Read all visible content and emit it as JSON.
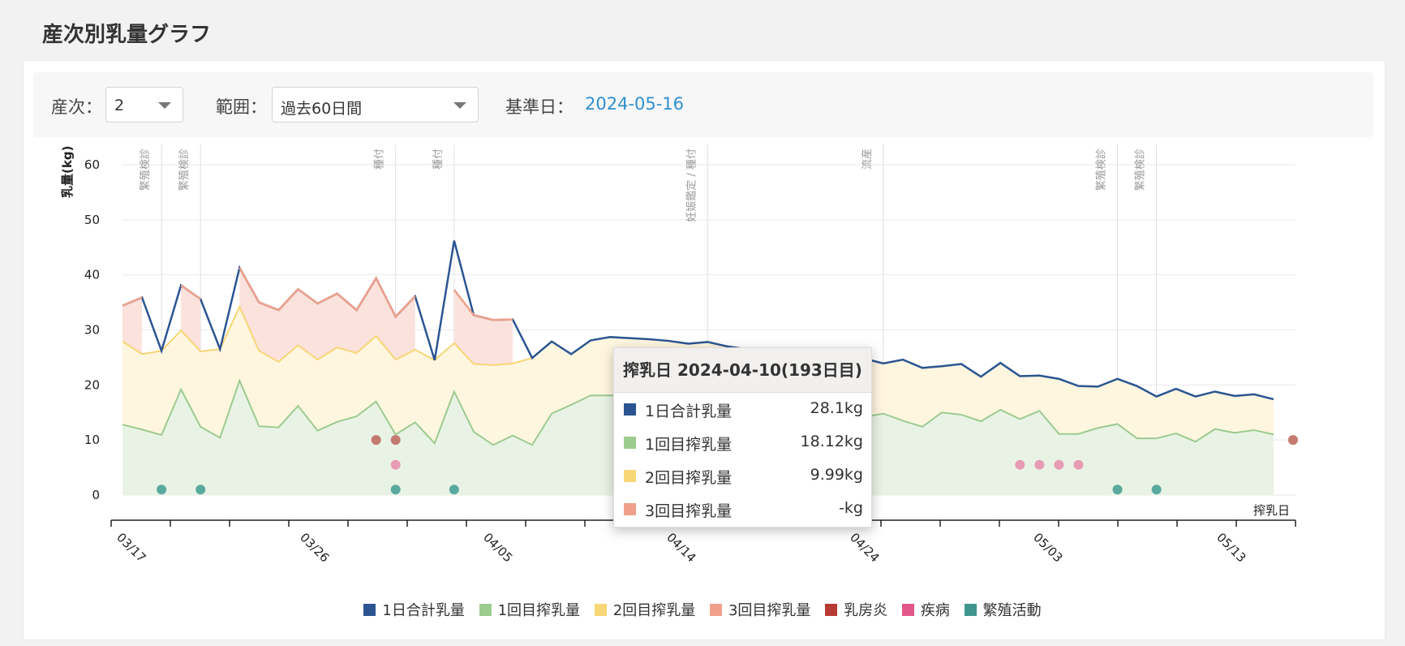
{
  "page_title": "産次別乳量グラフ",
  "filters": {
    "parity_label": "産次：",
    "parity_value": "2",
    "range_label": "範囲：",
    "range_value": "過去60日間",
    "base_date_label": "基準日：",
    "base_date_value": "2024-05-16"
  },
  "colors": {
    "total": "#2b5592",
    "milk1": "#9ccb8f",
    "milk2": "#f7d675",
    "milk3": "#f0a08a",
    "mastitis": "#b83a32",
    "disease": "#e2578a",
    "breeding": "#3e968e",
    "marker_mastitis": "#c47a6e",
    "marker_disease": "#e89bb4",
    "marker_breeding": "#5aa99e"
  },
  "tooltip": {
    "title": "搾乳日 2024-04-10(193日目)",
    "rows": [
      {
        "name": "1日合計乳量",
        "value": "28.1kg",
        "color_key": "total"
      },
      {
        "name": "1回目搾乳量",
        "value": "18.12kg",
        "color_key": "milk1"
      },
      {
        "name": "2回目搾乳量",
        "value": "9.99kg",
        "color_key": "milk2"
      },
      {
        "name": "3回目搾乳量",
        "value": "-kg",
        "color_key": "milk3"
      }
    ]
  },
  "legend": [
    {
      "label": "1日合計乳量",
      "color_key": "total"
    },
    {
      "label": "1回目搾乳量",
      "color_key": "milk1"
    },
    {
      "label": "2回目搾乳量",
      "color_key": "milk2"
    },
    {
      "label": "3回目搾乳量",
      "color_key": "milk3"
    },
    {
      "label": "乳房炎",
      "color_key": "mastitis"
    },
    {
      "label": "疾病",
      "color_key": "disease"
    },
    {
      "label": "繁殖活動",
      "color_key": "breeding"
    }
  ],
  "chart_data": {
    "type": "area",
    "ylabel": "乳量(kg)",
    "xlabel": "搾乳日",
    "ylim": [
      0,
      60
    ],
    "yticks": [
      0,
      10,
      20,
      30,
      40,
      50,
      60
    ],
    "x_start": "03/16",
    "x_end": "05/16",
    "x_tick_labels": [
      "03/17",
      "03/26",
      "04/05",
      "04/14",
      "04/24",
      "05/03",
      "05/13"
    ],
    "grid": true,
    "legend_position": "bottom",
    "series": [
      {
        "name": "1回目搾乳量",
        "color_key": "milk1",
        "values": [
          12.8,
          11.9,
          10.9,
          19.2,
          12.4,
          10.4,
          20.8,
          12.5,
          12.3,
          16.2,
          11.7,
          13.3,
          14.3,
          17.0,
          11.0,
          13.2,
          9.4,
          18.8,
          11.5,
          9.1,
          10.8,
          9.1,
          14.8,
          16.4,
          18.1,
          18.1,
          18.1,
          18.1,
          18.1,
          18.0,
          18.0,
          18.0,
          16.5,
          16.5,
          16.5,
          16.5,
          16.0,
          15.5,
          14.2,
          14.8,
          13.5,
          12.4,
          15.0,
          14.6,
          13.4,
          15.5,
          13.8,
          15.3,
          11.1,
          11.1,
          12.2,
          12.9,
          10.3,
          10.3,
          11.2,
          9.7,
          12.0,
          11.3,
          11.8,
          11.0
        ]
      },
      {
        "name": "2回目搾乳量",
        "color_key": "milk2",
        "values": [
          27.9,
          25.6,
          26.2,
          29.9,
          26.1,
          26.5,
          34.2,
          26.2,
          24.2,
          27.2,
          24.6,
          26.8,
          25.8,
          28.9,
          24.6,
          26.4,
          24.5,
          27.6,
          23.8,
          23.6,
          23.9,
          24.9,
          27.9,
          25.6,
          28.1,
          28.7,
          28.5,
          28.3,
          28.0,
          27.5,
          27.8,
          27.0,
          26.5,
          26.0,
          26.0,
          25.5,
          25.0,
          25.0,
          24.8,
          23.9,
          24.6,
          23.1,
          23.4,
          23.8,
          21.5,
          24.0,
          21.6,
          21.7,
          21.1,
          19.8,
          19.7,
          21.1,
          19.8,
          17.9,
          19.3,
          17.9,
          18.8,
          18.0,
          18.3,
          17.4
        ]
      },
      {
        "name": "3回目搾乳量",
        "color_key": "milk3",
        "values": [
          34.4,
          35.9,
          null,
          38.1,
          35.6,
          null,
          41.3,
          35.0,
          33.6,
          37.4,
          34.8,
          36.6,
          33.6,
          39.4,
          32.4,
          36.1,
          null,
          37.3,
          32.7,
          31.8,
          31.9,
          null,
          null,
          null,
          null,
          null,
          null,
          null,
          null,
          null,
          null,
          null,
          null,
          null,
          null,
          null,
          null,
          null,
          null,
          null,
          null,
          null,
          null,
          null,
          null,
          null,
          null,
          null,
          null,
          null,
          null,
          null,
          null,
          null,
          null,
          null,
          null,
          null,
          null,
          null
        ]
      },
      {
        "name": "1日合計乳量",
        "color_key": "total",
        "values": [
          34.4,
          35.9,
          26.2,
          38.1,
          35.6,
          26.5,
          41.3,
          35.0,
          33.6,
          37.4,
          34.8,
          36.6,
          33.6,
          39.4,
          32.4,
          36.1,
          24.5,
          46.2,
          32.7,
          31.8,
          31.9,
          24.9,
          27.9,
          25.6,
          28.1,
          28.7,
          28.5,
          28.3,
          28.0,
          27.5,
          27.8,
          27.0,
          26.5,
          26.0,
          26.0,
          25.5,
          25.0,
          25.0,
          24.8,
          23.9,
          24.6,
          23.1,
          23.4,
          23.8,
          21.5,
          24.0,
          21.6,
          21.7,
          21.1,
          19.8,
          19.7,
          21.1,
          19.8,
          17.9,
          19.3,
          17.9,
          18.8,
          18.0,
          18.3,
          17.4
        ]
      }
    ],
    "event_markers": [
      {
        "day": 2,
        "y": 1,
        "type": "breeding"
      },
      {
        "day": 4,
        "y": 1,
        "type": "breeding"
      },
      {
        "day": 13,
        "y": 10,
        "type": "mastitis"
      },
      {
        "day": 14,
        "y": 10,
        "type": "mastitis"
      },
      {
        "day": 14,
        "y": 5.5,
        "type": "disease"
      },
      {
        "day": 14,
        "y": 1,
        "type": "breeding"
      },
      {
        "day": 17,
        "y": 1,
        "type": "breeding"
      },
      {
        "day": 38,
        "y": 1,
        "type": "breeding"
      },
      {
        "day": 46,
        "y": 5.5,
        "type": "disease"
      },
      {
        "day": 47,
        "y": 5.5,
        "type": "disease"
      },
      {
        "day": 48,
        "y": 5.5,
        "type": "disease"
      },
      {
        "day": 49,
        "y": 5.5,
        "type": "disease"
      },
      {
        "day": 51,
        "y": 1,
        "type": "breeding"
      },
      {
        "day": 53,
        "y": 1,
        "type": "breeding"
      },
      {
        "day": 60,
        "y": 10,
        "type": "mastitis"
      }
    ],
    "event_lines": [
      {
        "day": 2,
        "label": "繁殖検診"
      },
      {
        "day": 4,
        "label": "繁殖検診"
      },
      {
        "day": 14,
        "label": "種付"
      },
      {
        "day": 17,
        "label": "種付"
      },
      {
        "day": 30,
        "label": "妊娠鑑定 / 種付"
      },
      {
        "day": 39,
        "label": "流産"
      },
      {
        "day": 51,
        "label": "繁殖検診"
      },
      {
        "day": 53,
        "label": "繁殖検診"
      }
    ]
  }
}
